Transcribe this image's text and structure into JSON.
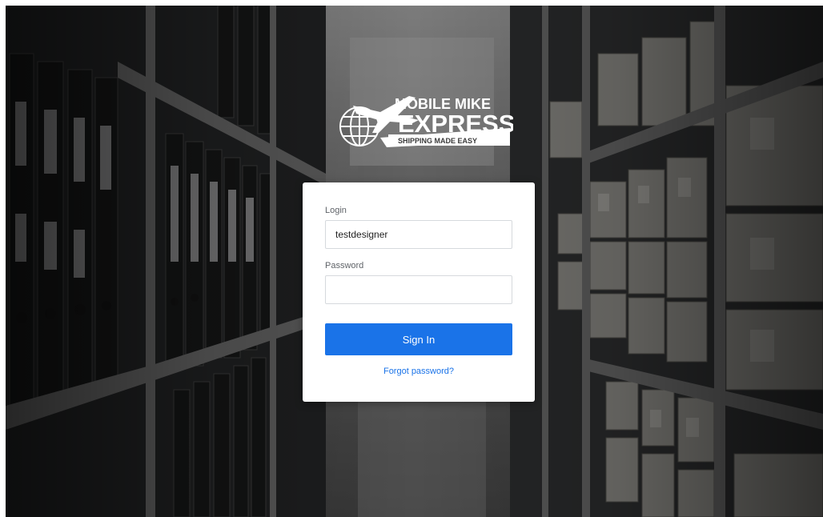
{
  "brand": {
    "name_line1": "MOBILE MIKE",
    "name_line2": "EXPRESS",
    "tagline": "SHIPPING MADE EASY",
    "logo_icons": [
      "globe-icon",
      "airplane-icon"
    ]
  },
  "login_form": {
    "login_label": "Login",
    "login_value": "testdesigner",
    "password_label": "Password",
    "password_value": "",
    "sign_in_label": "Sign In",
    "forgot_password_label": "Forgot password?"
  },
  "colors": {
    "accent": "#1a73e8",
    "card_background": "#ffffff",
    "input_border": "#d6d9dd",
    "label_text": "#5f6368"
  }
}
